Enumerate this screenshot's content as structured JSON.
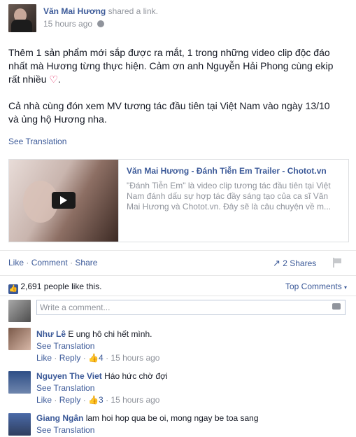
{
  "post": {
    "author": "Văn Mai Hương",
    "action": "shared a link.",
    "time": "15 hours ago",
    "text_line1": "Thêm 1 sản phẩm mới sắp được ra mắt, 1 trong những video clip độc đáo",
    "text_line2": "nhất mà Hương từng thực hiện. Cảm ơn anh Nguyễn Hải Phong cùng ekip",
    "text_line3": "rất nhiều",
    "text_line4": "Cả nhà cùng đón xem MV tương tác đầu tiên tại Việt Nam vào ngày 13/10",
    "text_line5": "và ủng hộ Hương nha.",
    "see_translation": "See Translation"
  },
  "link_card": {
    "title": "Văn Mai Hương - Đánh Tiễn Em Trailer - Chotot.vn",
    "desc_line1": "\"Đánh Tiễn Em\" là video clip tương tác đầu tiên tại Việt",
    "desc_line2": "Nam đánh dấu sự hợp tác đầy sáng tạo của ca sĩ Văn",
    "desc_line3": "Mai Hương và Chotot.vn. Đây sẽ là câu chuyện về m..."
  },
  "actions": {
    "like": "Like",
    "comment": "Comment",
    "share": "Share",
    "shares": "2 Shares"
  },
  "likes": {
    "text": "2,691 people like this.",
    "top_comments": "Top Comments"
  },
  "composer": {
    "placeholder": "Write a comment..."
  },
  "comments": [
    {
      "author": "Như Lê",
      "text": "E ung hô chi hết mình.",
      "see_translation": "See Translation",
      "like": "Like",
      "reply": "Reply",
      "likes": "4",
      "time": "15 hours ago"
    },
    {
      "author": "Nguyen The Viet",
      "text": "Háo hức chờ đợi",
      "see_translation": "See Translation",
      "like": "Like",
      "reply": "Reply",
      "likes": "3",
      "time": "15 hours ago"
    },
    {
      "author": "Giang Ngân",
      "text": "lam hoi hop qua be oi, mong ngay be toa sang",
      "see_translation": "See Translation"
    }
  ],
  "colors": {
    "link": "#3b5998",
    "heart": "#e0245e"
  }
}
